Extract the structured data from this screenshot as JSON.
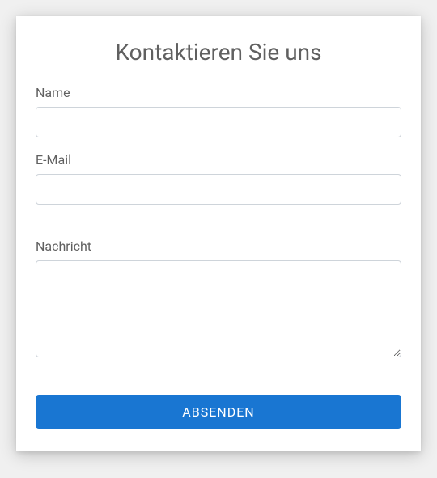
{
  "form": {
    "title": "Kontaktieren Sie uns",
    "fields": {
      "name": {
        "label": "Name",
        "value": ""
      },
      "email": {
        "label": "E-Mail",
        "value": ""
      },
      "message": {
        "label": "Nachricht",
        "value": ""
      }
    },
    "submit_label": "ABSENDEN"
  }
}
